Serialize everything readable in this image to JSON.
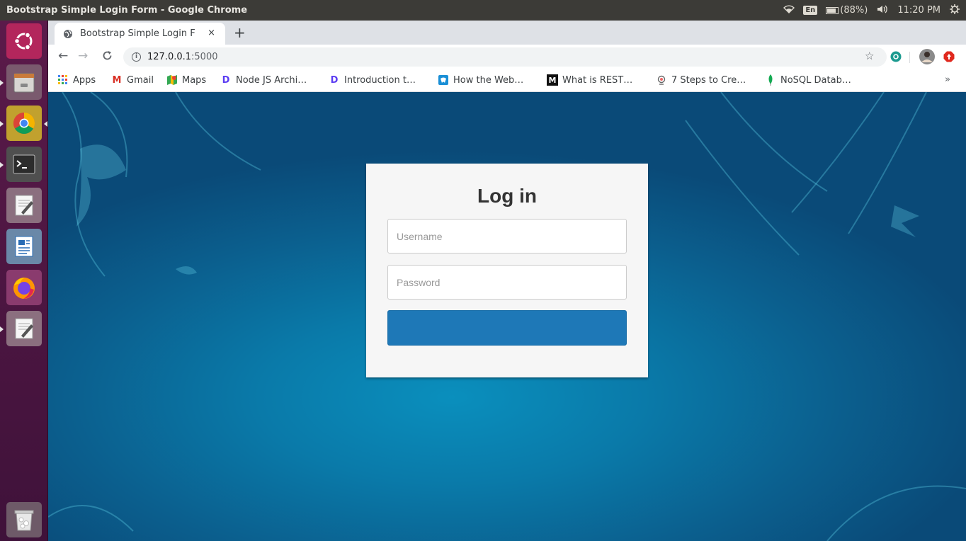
{
  "os": {
    "window_title": "Bootstrap Simple Login Form - Google Chrome",
    "keyboard_layout": "En",
    "battery": "(88%)",
    "clock": "11:20 PM"
  },
  "browser": {
    "tab": {
      "title": "Bootstrap Simple Login F",
      "close": "×"
    },
    "new_tab": "+",
    "url_host": "127.0.0.1",
    "url_port": ":5000",
    "bookmarks": [
      {
        "label": "Apps",
        "icon": "apps-grid-icon"
      },
      {
        "label": "Gmail",
        "icon": "gmail-icon"
      },
      {
        "label": "Maps",
        "icon": "maps-icon"
      },
      {
        "label": "Node JS Archi…",
        "icon": "dev-icon"
      },
      {
        "label": "Introduction t…",
        "icon": "dev-icon"
      },
      {
        "label": "How the Web…",
        "icon": "site-icon"
      },
      {
        "label": "What is REST…",
        "icon": "medium-icon"
      },
      {
        "label": "7 Steps to Cre…",
        "icon": "site-icon"
      },
      {
        "label": "NoSQL Datab…",
        "icon": "mongodb-leaf-icon"
      }
    ],
    "bookmarks_overflow": "»"
  },
  "login": {
    "title": "Log in",
    "username_placeholder": "Username",
    "password_placeholder": "Password",
    "submit_label": ""
  },
  "colors": {
    "launcher": "#4a1540",
    "panel": "#3c3b37",
    "submit_button": "#1e78b7",
    "background": "#0a7aa9"
  }
}
